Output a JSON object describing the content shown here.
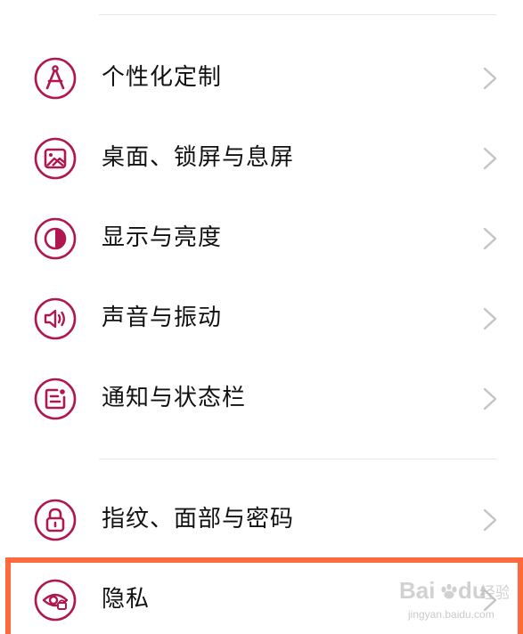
{
  "colors": {
    "accent": "#b0164f",
    "chevron": "#c4c4c4",
    "highlight": "#ff6a3d",
    "divider": "#e6e6e6"
  },
  "settings": {
    "items": [
      {
        "label": "个性化定制",
        "icon": "compass-icon"
      },
      {
        "label": "桌面、锁屏与息屏",
        "icon": "wallpaper-icon"
      },
      {
        "label": "显示与亮度",
        "icon": "contrast-icon"
      },
      {
        "label": "声音与振动",
        "icon": "speaker-icon"
      },
      {
        "label": "通知与状态栏",
        "icon": "notification-icon"
      },
      {
        "label": "指纹、面部与密码",
        "icon": "lock-icon"
      },
      {
        "label": "隐私",
        "icon": "privacy-eye-icon"
      }
    ]
  },
  "watermark": {
    "brand": "Bai",
    "brand2": "du",
    "cn": "经验",
    "url": "jingyan.baidu.com"
  }
}
